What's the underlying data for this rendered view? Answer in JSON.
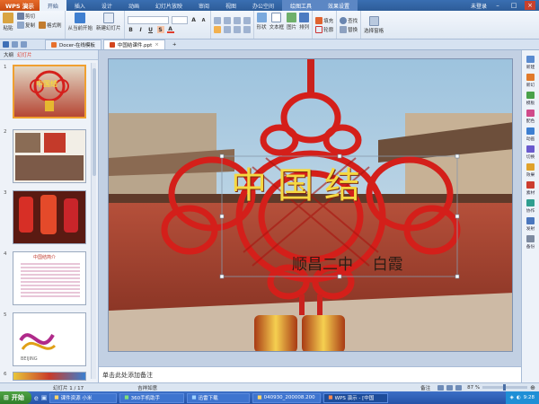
{
  "app": {
    "name": "WPS 演示",
    "menus": [
      "开始",
      "插入",
      "设计",
      "动画",
      "幻灯片放映",
      "审阅",
      "视图",
      "办公空间",
      "绘图工具",
      "效果设置"
    ],
    "status_right": "未登录"
  },
  "ribbon": {
    "paste": "粘贴",
    "cut": "剪切",
    "copy": "复制",
    "format_painter": "格式刷",
    "from_current": "从当前开始",
    "new_slide": "新建幻灯片",
    "font_name": "",
    "font_size": "",
    "shape": "形状",
    "textbox": "文本框",
    "picture": "图片",
    "arrange": "排列",
    "fill": "填充",
    "outline": "轮廓",
    "find": "查找",
    "replace": "替换",
    "select_pane": "选择窗格"
  },
  "tabs": {
    "doc1": "Docer-在线模板",
    "doc2": "中国结课件.ppt",
    "add": "+"
  },
  "left_panel": {
    "tab_outline": "大纲",
    "tab_slides": "幻灯片",
    "slide_numbers": [
      "1",
      "2",
      "3",
      "4",
      "5",
      "6"
    ],
    "thumb_titles": [
      "中国结",
      "",
      "",
      "中国结简介",
      "",
      ""
    ]
  },
  "slide": {
    "title": "中国结",
    "subtitle": "顺昌二中    白霞"
  },
  "notes": {
    "placeholder": "单击此处添加备注"
  },
  "right_pane": {
    "items": [
      "新建",
      "新幻",
      "模板",
      "配色",
      "动画",
      "切换",
      "效果",
      "素材",
      "协作",
      "发射",
      "备份"
    ]
  },
  "statusbar": {
    "slide_info": "幻灯片 1 / 17",
    "theme": "吉祥如意",
    "notes_btn": "备注",
    "zoom": "87 %",
    "zoom_value": 0.87
  },
  "taskbar": {
    "start": "开始",
    "tasks": [
      "课件资源 小米",
      "360手机助手",
      "迅雷下载",
      "040930_200008.200",
      "WPS 演示 - [中国"
    ],
    "clock": "9:28"
  },
  "colors": {
    "title_red": "#e03b2b",
    "selected_thumb": "#f0a030",
    "title_yellow": "#f5d842"
  }
}
